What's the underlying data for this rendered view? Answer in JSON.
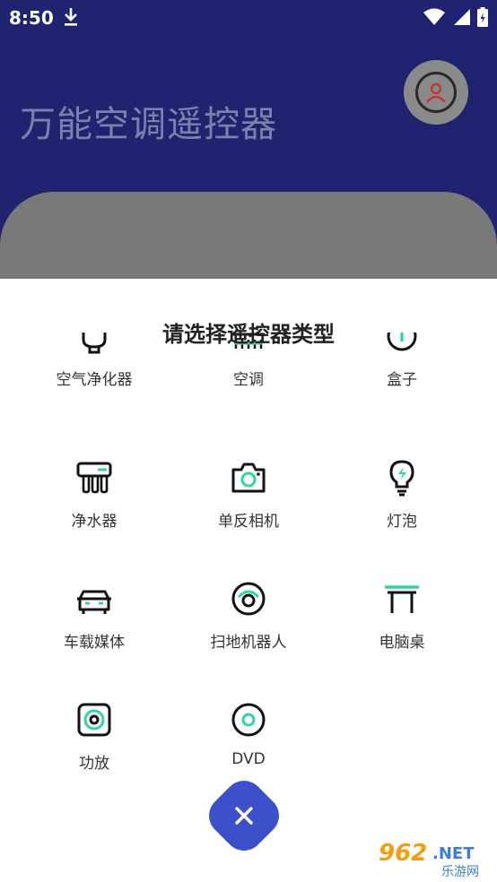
{
  "status": {
    "time": "8:50"
  },
  "header": {
    "title": "万能空调遥控器"
  },
  "sheet": {
    "title": "请选择遥控器类型",
    "items": [
      {
        "label": "空气净化器",
        "icon": "air-purifier-icon"
      },
      {
        "label": "空调",
        "icon": "air-conditioner-icon"
      },
      {
        "label": "盒子",
        "icon": "power-box-icon"
      },
      {
        "label": "净水器",
        "icon": "water-purifier-icon"
      },
      {
        "label": "单反相机",
        "icon": "camera-icon"
      },
      {
        "label": "灯泡",
        "icon": "light-bulb-icon"
      },
      {
        "label": "车载媒体",
        "icon": "car-icon"
      },
      {
        "label": "扫地机器人",
        "icon": "robot-vacuum-icon"
      },
      {
        "label": "电脑桌",
        "icon": "desk-icon"
      },
      {
        "label": "功放",
        "icon": "speaker-icon"
      },
      {
        "label": "DVD",
        "icon": "disc-icon"
      }
    ]
  },
  "watermark": {
    "text": "962.NET",
    "subtext": "乐游网"
  },
  "colors": {
    "header": "#1f2370",
    "accent": "#3d4fc9",
    "icon_accent": "#2fd5a3"
  }
}
